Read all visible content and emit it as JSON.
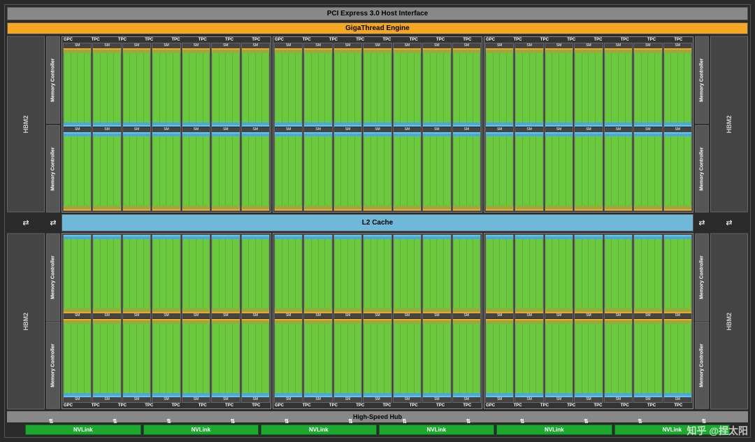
{
  "labels": {
    "pci": "PCI Express 3.0 Host Interface",
    "gigathread": "GigaThread Engine",
    "hbm": "HBM2",
    "memctl": "Memory Controller",
    "gpc": "GPC",
    "tpc": "TPC",
    "sm": "SM",
    "l2": "L2 Cache",
    "hsh": "High-Speed Hub",
    "nvlink": "NVLink"
  },
  "counts": {
    "gpc_rows": 2,
    "gpcs_per_row": 3,
    "tpcs_per_gpc": 7,
    "sms_per_tpc": 2,
    "hbm_per_side": 2,
    "memctl_per_side": 4,
    "nvlinks": 6
  },
  "watermark": "知乎 @捏太阳"
}
